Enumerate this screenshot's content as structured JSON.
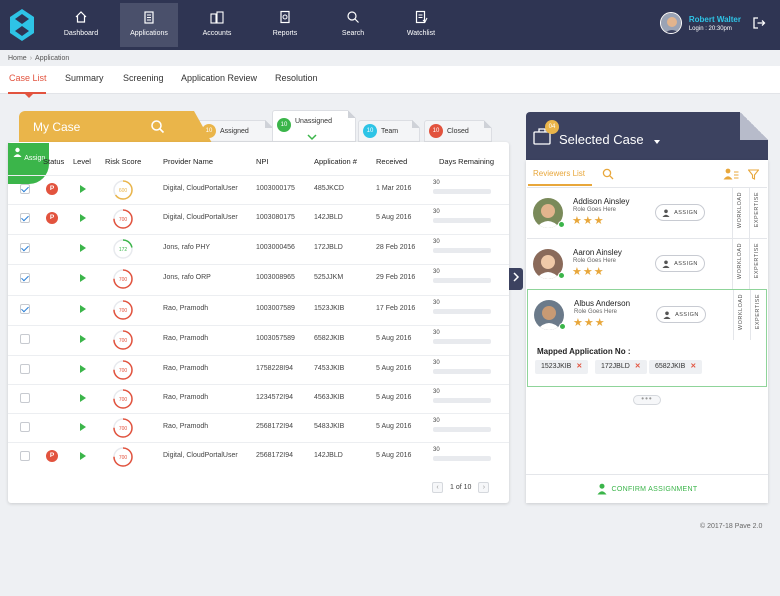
{
  "nav": {
    "items": [
      {
        "label": "Dashboard",
        "icon": "home-icon"
      },
      {
        "label": "Applications",
        "icon": "clipboard-icon"
      },
      {
        "label": "Accounts",
        "icon": "buildings-icon"
      },
      {
        "label": "Reports",
        "icon": "report-icon"
      },
      {
        "label": "Search",
        "icon": "search-icon"
      },
      {
        "label": "Watchlist",
        "icon": "watchlist-icon"
      }
    ],
    "active": "Applications"
  },
  "user": {
    "name": "Robert Walter",
    "login": "Login : 20:30pm"
  },
  "breadcrumb": {
    "home": "Home",
    "separator": "›",
    "current": "Application"
  },
  "tabs": [
    "Case List",
    "Summary",
    "Screening",
    "Application Review",
    "Resolution"
  ],
  "mycase": {
    "title": "My Case",
    "filters": [
      {
        "count": "10",
        "label": "Assigned",
        "color": "#eab54a"
      },
      {
        "count": "10",
        "label": "Unassigned",
        "color": "#3bb54a"
      },
      {
        "count": "10",
        "label": "Team",
        "color": "#2ec4e6"
      },
      {
        "count": "10",
        "label": "Closed",
        "color": "#e2533e"
      }
    ],
    "assign_label": "Assign"
  },
  "table": {
    "headers": [
      "Status",
      "Level",
      "Risk Score",
      "Provider Name",
      "NPI",
      "Application #",
      "Received",
      "Days Remaining"
    ],
    "rows": [
      {
        "checked": true,
        "status": "P",
        "risk": "600",
        "risk_color": "#eab54a",
        "provider": "Digital, CloudPortalUser",
        "npi": "1003000175",
        "app": "485JKCD",
        "received": "1 Mar 2016",
        "days": "30"
      },
      {
        "checked": true,
        "status": "P",
        "risk": "700",
        "risk_color": "#e2533e",
        "provider": "Digital, CloudPortalUser",
        "npi": "1003080175",
        "app": "142JBLD",
        "received": "5 Aug 2016",
        "days": "30"
      },
      {
        "checked": true,
        "status": "",
        "risk": "172",
        "risk_color": "#3bb54a",
        "provider": "Jons, rafo PHY",
        "npi": "1003000456",
        "app": "172JBLD",
        "received": "28 Feb 2016",
        "days": "30"
      },
      {
        "checked": true,
        "status": "",
        "risk": "700",
        "risk_color": "#e2533e",
        "provider": "Jons, rafo ORP",
        "npi": "1003008965",
        "app": "525JJKM",
        "received": "29 Feb 2016",
        "days": "30"
      },
      {
        "checked": true,
        "status": "",
        "risk": "700",
        "risk_color": "#e2533e",
        "provider": "Rao, Pramodh",
        "npi": "1003007589",
        "app": "1523JKIB",
        "received": "17 Feb 2016",
        "days": "30"
      },
      {
        "checked": false,
        "status": "",
        "risk": "700",
        "risk_color": "#e2533e",
        "provider": "Rao, Pramodh",
        "npi": "1003057589",
        "app": "6582JKIB",
        "received": "5 Aug 2016",
        "days": "30"
      },
      {
        "checked": false,
        "status": "",
        "risk": "700",
        "risk_color": "#e2533e",
        "provider": "Rao, Pramodh",
        "npi": "1758228I94",
        "app": "7453JKIB",
        "received": "5 Aug 2016",
        "days": "30"
      },
      {
        "checked": false,
        "status": "",
        "risk": "700",
        "risk_color": "#e2533e",
        "provider": "Rao, Pramodh",
        "npi": "1234572I94",
        "app": "4563JKIB",
        "received": "5 Aug 2016",
        "days": "30"
      },
      {
        "checked": false,
        "status": "",
        "risk": "700",
        "risk_color": "#e2533e",
        "provider": "Rao, Pramodh",
        "npi": "2568172I94",
        "app": "5483JKIB",
        "received": "5 Aug 2016",
        "days": "30"
      },
      {
        "checked": false,
        "status": "P",
        "risk": "700",
        "risk_color": "#e2533e",
        "provider": "Digital, CloudPortalUser",
        "npi": "2568172I94",
        "app": "142JBLD",
        "received": "5 Aug 2016",
        "days": "30"
      }
    ],
    "pager": "1 of 10"
  },
  "selected": {
    "title": "Selected Case",
    "badge": "04",
    "reviewers_tab": "Reviewers List",
    "reviewers": [
      {
        "name": "Addison Ainsley",
        "role": "Role Goes Here",
        "stars": "★★★",
        "assign": "ASSIGN"
      },
      {
        "name": "Aaron Ainsley",
        "role": "Role Goes Here",
        "stars": "★★★",
        "assign": "ASSIGN"
      },
      {
        "name": "Albus Anderson",
        "role": "Role Goes Here",
        "stars": "★★★",
        "assign": "ASSIGN"
      }
    ],
    "workload_label": "WORKLOAD",
    "expertise_label": "EXPERTISE",
    "mapped_label": "Mapped  Application No :",
    "mapped": [
      "1523JKIB",
      "172JBLD",
      "6582JKIB"
    ],
    "chip_remove": "✕",
    "more": "•••",
    "confirm": "CONFIRM ASSIGNMENT"
  },
  "footer": "© 2017-18  Pave 2.0"
}
